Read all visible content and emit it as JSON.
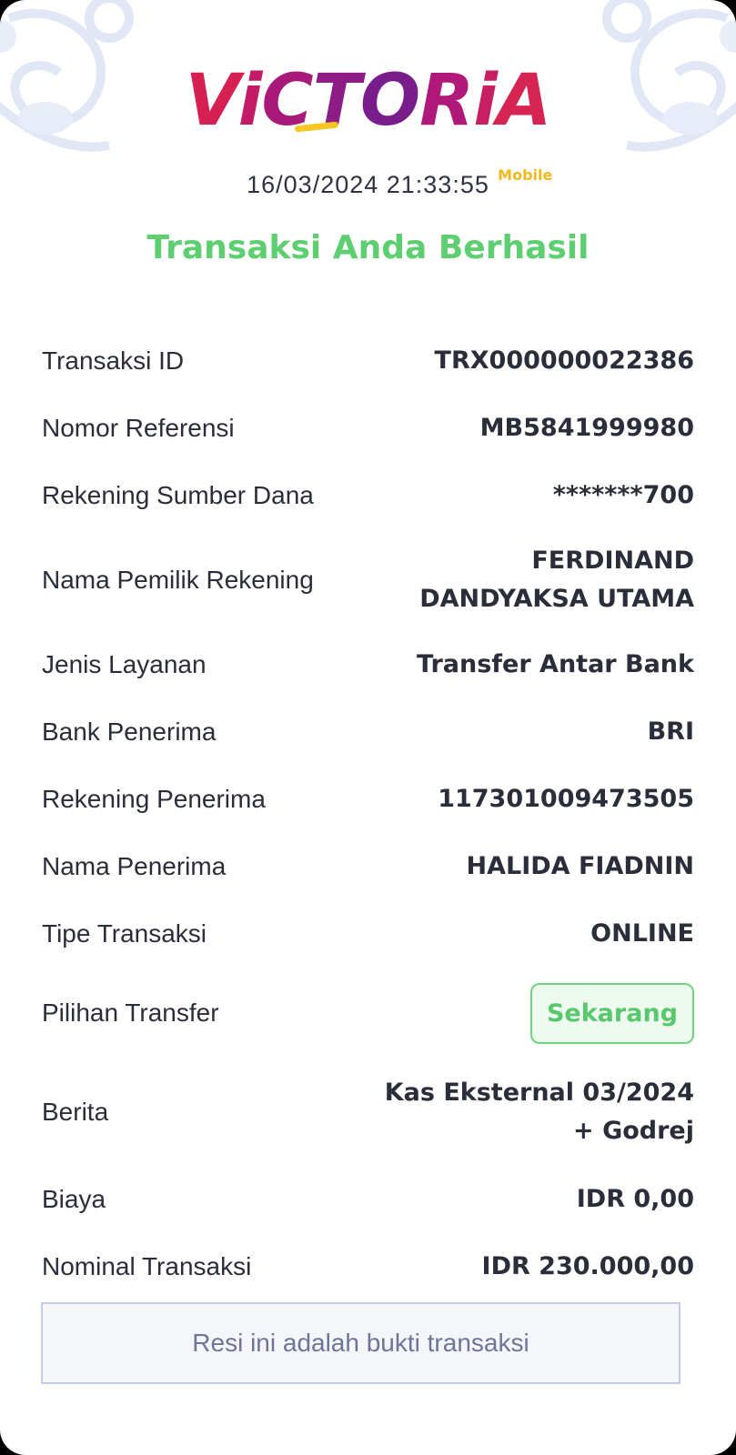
{
  "brand": {
    "logo_text": "ViCTORiA",
    "logo_sub": "Mobile",
    "colors": {
      "magenta": "#b0197a",
      "yellow": "#f2b81c"
    }
  },
  "header": {
    "datetime": "16/03/2024 21:33:55",
    "status": "Transaksi Anda Berhasil",
    "status_color": "#5dcf70"
  },
  "details": [
    {
      "label": "Transaksi ID",
      "value": "TRX000000022386"
    },
    {
      "label": "Nomor Referensi",
      "value": "MB5841999980"
    },
    {
      "label": "Rekening Sumber Dana",
      "value": "*******700"
    },
    {
      "label": "Nama Pemilik Rekening",
      "value_line1": "FERDINAND",
      "value_line2": "DANDYAKSA UTAMA"
    },
    {
      "label": "Jenis Layanan",
      "value": "Transfer Antar Bank"
    },
    {
      "label": "Bank Penerima",
      "value": "BRI"
    },
    {
      "label": "Rekening Penerima",
      "value": "117301009473505"
    },
    {
      "label": "Nama Penerima",
      "value": "HALIDA FIADNIN"
    },
    {
      "label": "Tipe Transaksi",
      "value": "ONLINE"
    },
    {
      "label": "Pilihan Transfer",
      "value": "Sekarang"
    },
    {
      "label": "Berita",
      "value_line1": "Kas Eksternal 03/2024",
      "value_line2": "+ Godrej"
    },
    {
      "label": "Biaya",
      "value": "IDR 0,00"
    },
    {
      "label": "Nominal Transaksi",
      "value": "IDR 230.000,00"
    }
  ],
  "footer": {
    "note": "Resi ini adalah bukti transaksi"
  }
}
